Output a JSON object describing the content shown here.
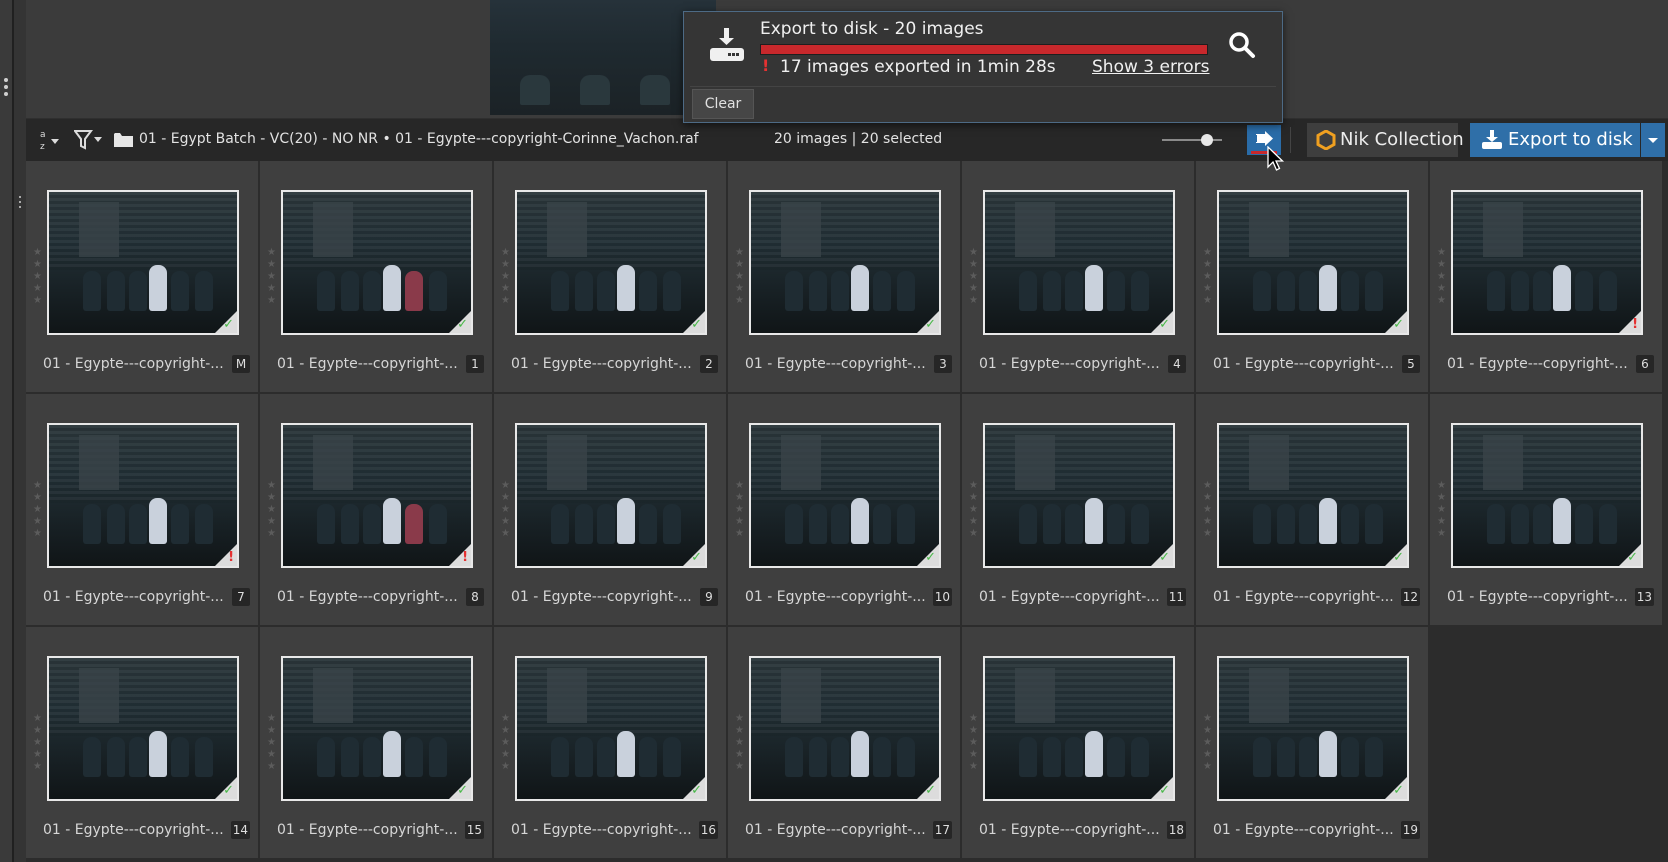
{
  "export_popup": {
    "title": "Export to disk - 20 images",
    "progress": 1.0,
    "status": "17 images exported in 1min 28s",
    "errors_link": "Show 3 errors",
    "clear_label": "Clear",
    "warning_glyph": "!",
    "progress_color": "#c8282c"
  },
  "toolbar": {
    "sort_icon": "sort-az-icon",
    "filter_icon": "filter-icon",
    "path": "01 - Egypt Batch - VC(20) - NO NR  •  01 - Egypte---copyright-Corinne_Vachon.raf",
    "count": "20 images | 20 selected",
    "thumbnail_size": 0.75,
    "nik_label": "Nik Collection",
    "export_label": "Export to disk",
    "accent": "#2f6fa8"
  },
  "grid": {
    "items": [
      {
        "name": "01 - Egypte---copyright-...",
        "badge": "M",
        "status": "ok"
      },
      {
        "name": "01 - Egypte---copyright-...",
        "badge": "1",
        "status": "ok"
      },
      {
        "name": "01 - Egypte---copyright-...",
        "badge": "2",
        "status": "ok"
      },
      {
        "name": "01 - Egypte---copyright-...",
        "badge": "3",
        "status": "ok"
      },
      {
        "name": "01 - Egypte---copyright-...",
        "badge": "4",
        "status": "ok"
      },
      {
        "name": "01 - Egypte---copyright-...",
        "badge": "5",
        "status": "ok"
      },
      {
        "name": "01 - Egypte---copyright-...",
        "badge": "6",
        "status": "err"
      },
      {
        "name": "01 - Egypte---copyright-...",
        "badge": "7",
        "status": "err"
      },
      {
        "name": "01 - Egypte---copyright-...",
        "badge": "8",
        "status": "err"
      },
      {
        "name": "01 - Egypte---copyright-...",
        "badge": "9",
        "status": "ok"
      },
      {
        "name": "01 - Egypte---copyright-...",
        "badge": "10",
        "status": "ok"
      },
      {
        "name": "01 - Egypte---copyright-...",
        "badge": "11",
        "status": "ok"
      },
      {
        "name": "01 - Egypte---copyright-...",
        "badge": "12",
        "status": "ok"
      },
      {
        "name": "01 - Egypte---copyright-...",
        "badge": "13",
        "status": "ok"
      },
      {
        "name": "01 - Egypte---copyright-...",
        "badge": "14",
        "status": "ok"
      },
      {
        "name": "01 - Egypte---copyright-...",
        "badge": "15",
        "status": "ok"
      },
      {
        "name": "01 - Egypte---copyright-...",
        "badge": "16",
        "status": "ok"
      },
      {
        "name": "01 - Egypte---copyright-...",
        "badge": "17",
        "status": "ok"
      },
      {
        "name": "01 - Egypte---copyright-...",
        "badge": "18",
        "status": "ok"
      },
      {
        "name": "01 - Egypte---copyright-...",
        "badge": "19",
        "status": "ok"
      }
    ],
    "ok_glyph": "✓",
    "err_glyph": "!",
    "ok_color": "#49b849",
    "err_color": "#e53131"
  }
}
